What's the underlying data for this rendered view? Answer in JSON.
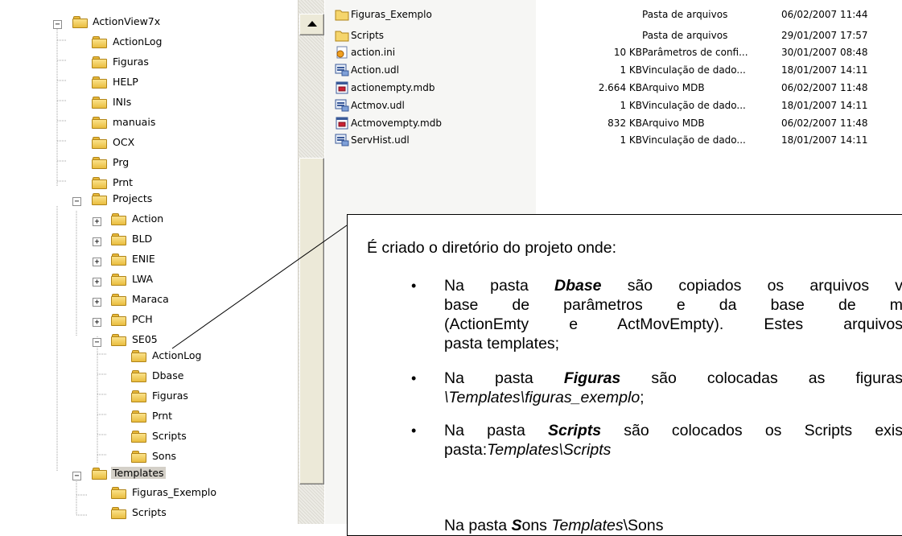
{
  "tree": {
    "items": [
      {
        "label": "ActionView7x",
        "level": 0,
        "expander": "minus"
      },
      {
        "label": "ActionLog",
        "level": 1
      },
      {
        "label": "Figuras",
        "level": 1
      },
      {
        "label": "HELP",
        "level": 1
      },
      {
        "label": "INIs",
        "level": 1
      },
      {
        "label": "manuais",
        "level": 1
      },
      {
        "label": "OCX",
        "level": 1
      },
      {
        "label": "Prg",
        "level": 1
      },
      {
        "label": "Prnt",
        "level": 1
      },
      {
        "label": "Projects",
        "level": 1,
        "expander": "minus"
      },
      {
        "label": "Action",
        "level": 2,
        "expander": "plus"
      },
      {
        "label": "BLD",
        "level": 2,
        "expander": "plus"
      },
      {
        "label": "ENIE",
        "level": 2,
        "expander": "plus"
      },
      {
        "label": "LWA",
        "level": 2,
        "expander": "plus"
      },
      {
        "label": "Maraca",
        "level": 2,
        "expander": "plus"
      },
      {
        "label": "PCH",
        "level": 2,
        "expander": "plus"
      },
      {
        "label": "SE05",
        "level": 2,
        "expander": "minus"
      },
      {
        "label": "ActionLog",
        "level": 3
      },
      {
        "label": "Dbase",
        "level": 3
      },
      {
        "label": "Figuras",
        "level": 3
      },
      {
        "label": "Prnt",
        "level": 3
      },
      {
        "label": "Scripts",
        "level": 3
      },
      {
        "label": "Sons",
        "level": 3
      },
      {
        "label": "Templates",
        "level": 1,
        "expander": "minus",
        "selected": true
      },
      {
        "label": "Figuras_Exemplo",
        "level": 2
      },
      {
        "label": "Scripts",
        "level": 2
      }
    ]
  },
  "files": [
    {
      "name": "Figuras_Exemplo",
      "size": "",
      "type": "Pasta de arquivos",
      "date": "06/02/2007 11:44",
      "icon": "folder-icon"
    },
    {
      "name": "Scripts",
      "size": "",
      "type": "Pasta de arquivos",
      "date": "29/01/2007 17:57",
      "icon": "folder-icon"
    },
    {
      "name": "action.ini",
      "size": "10 KB",
      "type": "Parâmetros de confi...",
      "date": "30/01/2007 08:48",
      "icon": "ini-file-icon"
    },
    {
      "name": "Action.udl",
      "size": "1 KB",
      "type": "Vinculação de dado...",
      "date": "18/01/2007 14:11",
      "icon": "udl-file-icon"
    },
    {
      "name": "actionempty.mdb",
      "size": "2.664 KB",
      "type": "Arquivo MDB",
      "date": "06/02/2007 11:48",
      "icon": "mdb-file-icon"
    },
    {
      "name": "Actmov.udl",
      "size": "1 KB",
      "type": "Vinculação de dado...",
      "date": "18/01/2007 14:11",
      "icon": "udl-file-icon"
    },
    {
      "name": "Actmovempty.mdb",
      "size": "832 KB",
      "type": "Arquivo MDB",
      "date": "06/02/2007 11:48",
      "icon": "mdb-file-icon"
    },
    {
      "name": "ServHist.udl",
      "size": "1 KB",
      "type": "Vinculação de dado...",
      "date": "18/01/2007 14:11",
      "icon": "udl-file-icon"
    }
  ],
  "callout": {
    "intro": "É criado o diretório do projeto onde:",
    "b1": {
      "l1_pre": "Na pasta ",
      "l1_bold": "Dbase",
      "l1_post": " são copiados os arquivos v",
      "l2": "base de parâmetros e da base de m",
      "l3": "(ActionEmty e ActMovEmpty). Estes arquivos",
      "l4": "pasta templates;"
    },
    "b2": {
      "l1_pre": "Na pasta ",
      "l1_bold": "Figuras",
      "l1_post": " são colocadas as figuras",
      "l2_italic": "\\Templates\\figuras_exemplo",
      "l2_post": ";"
    },
    "b3": {
      "l1_pre": "Na pasta ",
      "l1_bold": "Scripts",
      "l1_post": " são colocados os Scripts exis",
      "l2_pre": "pasta:",
      "l2_italic": "Templates\\Scripts"
    },
    "b4": {
      "l1_pre": "Na pasta ",
      "l1_bold": "S",
      "l1_mid": "ons ",
      "l1_italic": "Templates",
      "l1_post": "\\Sons"
    },
    "bullet": "•"
  }
}
